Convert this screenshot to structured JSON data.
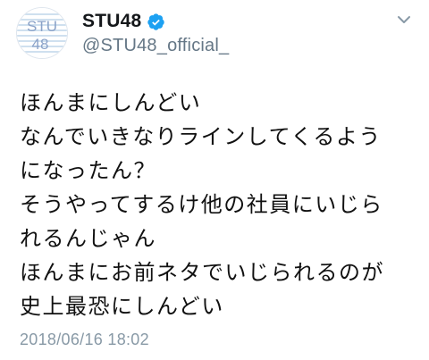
{
  "tweet": {
    "avatar": {
      "icon": "stu48-logo",
      "line1": "STU",
      "line2": "48",
      "stripe_color": "#cfe0ef",
      "text_color": "#8aa2c8"
    },
    "display_name": "STU48",
    "verified_icon": "verified-badge-icon",
    "verified_color": "#1da1f2",
    "handle": "@STU48_official_",
    "menu_icon": "chevron-down-icon",
    "text_lines": [
      "ほんまにしんどい",
      "なんでいきなりラインしてくるよう",
      "になったん？",
      "そうやってするけ他の社員にいじら",
      "れるんじゃん",
      "ほんまにお前ネタでいじられるのが",
      "史上最恐にしんどい"
    ],
    "timestamp": "2018/06/16 18:02"
  }
}
